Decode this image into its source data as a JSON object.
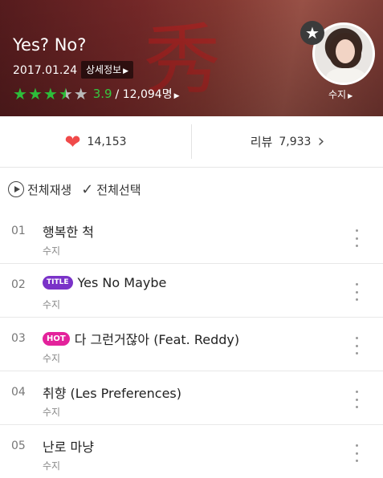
{
  "album": {
    "title": "Yes? No?",
    "release_date": "2017.01.24",
    "detail_label": "상세정보",
    "cover_glyph": "秀",
    "rating": {
      "stars": 3.5,
      "score": "3.9",
      "count": "/ 12,094명"
    }
  },
  "artist": {
    "name": "수지"
  },
  "stats": {
    "likes": "14,153",
    "review_label": "리뷰",
    "review_count": "7,933"
  },
  "actions": {
    "play_all": "전체재생",
    "select_all": "전체선택"
  },
  "tracks": [
    {
      "no": "01",
      "title": "행복한 척",
      "artist": "수지",
      "badge": ""
    },
    {
      "no": "02",
      "title": "Yes No Maybe",
      "artist": "수지",
      "badge": "TITLE"
    },
    {
      "no": "03",
      "title": "다 그런거잖아 (Feat. Reddy)",
      "artist": "수지",
      "badge": "HOT"
    },
    {
      "no": "04",
      "title": "취향 (Les Preferences)",
      "artist": "수지",
      "badge": ""
    },
    {
      "no": "05",
      "title": "난로 마냥",
      "artist": "수지",
      "badge": ""
    }
  ],
  "colors": {
    "star_green": "#2dbd3a",
    "heart_red": "#f04a4a",
    "title_badge": "#7a32c8",
    "hot_badge": "#e3229b"
  }
}
